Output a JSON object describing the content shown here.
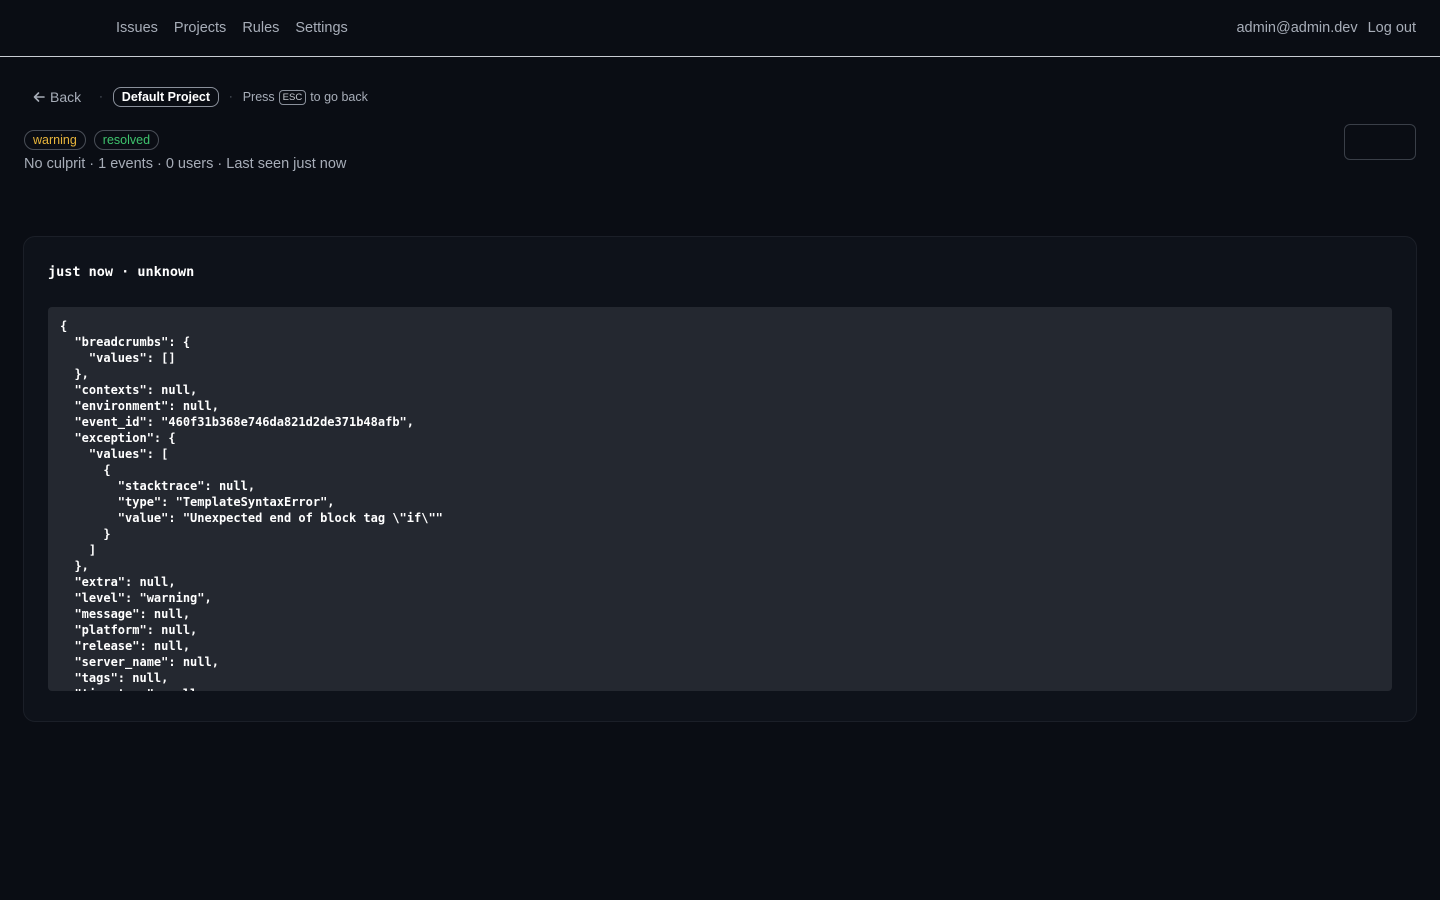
{
  "nav": {
    "issues": "Issues",
    "projects": "Projects",
    "rules": "Rules",
    "settings": "Settings",
    "user": "admin@admin.dev",
    "logout": "Log out"
  },
  "breadcrumb": {
    "back": "Back",
    "project": "Default Project",
    "press": "Press",
    "esc": "ESC",
    "go_back": "to go back"
  },
  "issue": {
    "level_badge": "warning",
    "status_badge": "resolved",
    "meta": "No culprit · 1 events · 0 users · Last seen just now"
  },
  "event": {
    "heading": "just now · unknown",
    "json_lines": [
      "{",
      "  \"breadcrumbs\": {",
      "    \"values\": []",
      "  },",
      "  \"contexts\": null,",
      "  \"environment\": null,",
      "  \"event_id\": \"460f31b368e746da821d2de371b48afb\",",
      "  \"exception\": {",
      "    \"values\": [",
      "      {",
      "        \"stacktrace\": null,",
      "        \"type\": \"TemplateSyntaxError\",",
      "        \"value\": \"Unexpected end of block tag \\\"if\\\"\"",
      "      }",
      "    ]",
      "  },",
      "  \"extra\": null,",
      "  \"level\": \"warning\",",
      "  \"message\": null,",
      "  \"platform\": null,",
      "  \"release\": null,",
      "  \"server_name\": null,",
      "  \"tags\": null,",
      "  \"timestamp\": null"
    ]
  },
  "colors": {
    "background": "#0a0d14",
    "warning": "#e8b53b",
    "resolved": "#3ec46d",
    "code_bg": "#242830"
  }
}
